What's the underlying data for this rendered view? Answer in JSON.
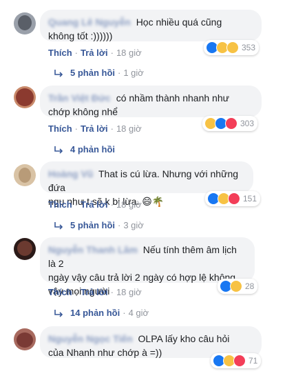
{
  "comments": [
    {
      "author": "Quang Lê Nguyễn",
      "text_lines": [
        "Học nhiều quá cũng",
        "không tốt :))))))"
      ],
      "actions": {
        "like": "Thích",
        "reply": "Trả lời",
        "time": "18 giờ"
      },
      "reaction_icons": [
        "like-icon",
        "haha-icon",
        "sad-icon"
      ],
      "reaction_count": "353",
      "replies": {
        "label": "5 phản hồi",
        "time": "1 giờ"
      },
      "avatar_color": "#6b6f78"
    },
    {
      "author": "Trần Việt Đức",
      "text_lines": [
        "có nhầm thành nhanh như",
        "chớp không nhể"
      ],
      "actions": {
        "like": "Thích",
        "reply": "Trả lời",
        "time": "18 giờ"
      },
      "reaction_icons": [
        "haha-icon",
        "like-icon",
        "love-icon"
      ],
      "reaction_count": "303",
      "replies": {
        "label": "4 phản hồi",
        "time": ""
      },
      "avatar_color": "#8b3a2f"
    },
    {
      "author": "Hoàng Vũ",
      "text_lines": [
        "That is cú lừa. Nhưng với những đứa",
        "ngu như t sẽ k bị lừa. 😄🌴"
      ],
      "actions": {
        "like": "Thích",
        "reply": "Trả lời",
        "time": "18 giờ"
      },
      "reaction_icons": [
        "like-icon",
        "haha-icon",
        "love-icon"
      ],
      "reaction_count": "151",
      "replies": {
        "label": "5 phản hồi",
        "time": "3 giờ"
      },
      "avatar_color": "#b89b78"
    },
    {
      "author": "Nguyễn Thanh Lâm",
      "text_lines": [
        "Nếu tính thêm âm lịch là 2",
        "ngày vậy câu trả lời 2 ngày có hợp lệ không",
        "vậy mọi người"
      ],
      "actions": {
        "like": "Thích",
        "reply": "Trả lời",
        "time": "18 giờ"
      },
      "reaction_icons": [
        "like-icon",
        "haha-icon"
      ],
      "reaction_count": "28",
      "replies": {
        "label": "14 phản hồi",
        "time": "4 giờ"
      },
      "avatar_color": "#4a2a25"
    },
    {
      "author": "Nguyễn Ngọc Tiến",
      "text_lines": [
        "OLPA lấy kho câu hỏi",
        "của Nhanh như chớp à =))"
      ],
      "actions": {
        "like": "",
        "reply": "",
        "time": ""
      },
      "reaction_icons": [
        "like-icon",
        "haha-icon",
        "love-icon"
      ],
      "reaction_count": "71",
      "replies": {
        "label": "",
        "time": ""
      },
      "avatar_color": "#7a3a35"
    }
  ],
  "colors": {
    "link": "#385898",
    "muted": "#90949c",
    "bubble": "#f2f3f5",
    "like": "#1877f2",
    "love": "#f33e58",
    "haha": "#f7c244"
  }
}
